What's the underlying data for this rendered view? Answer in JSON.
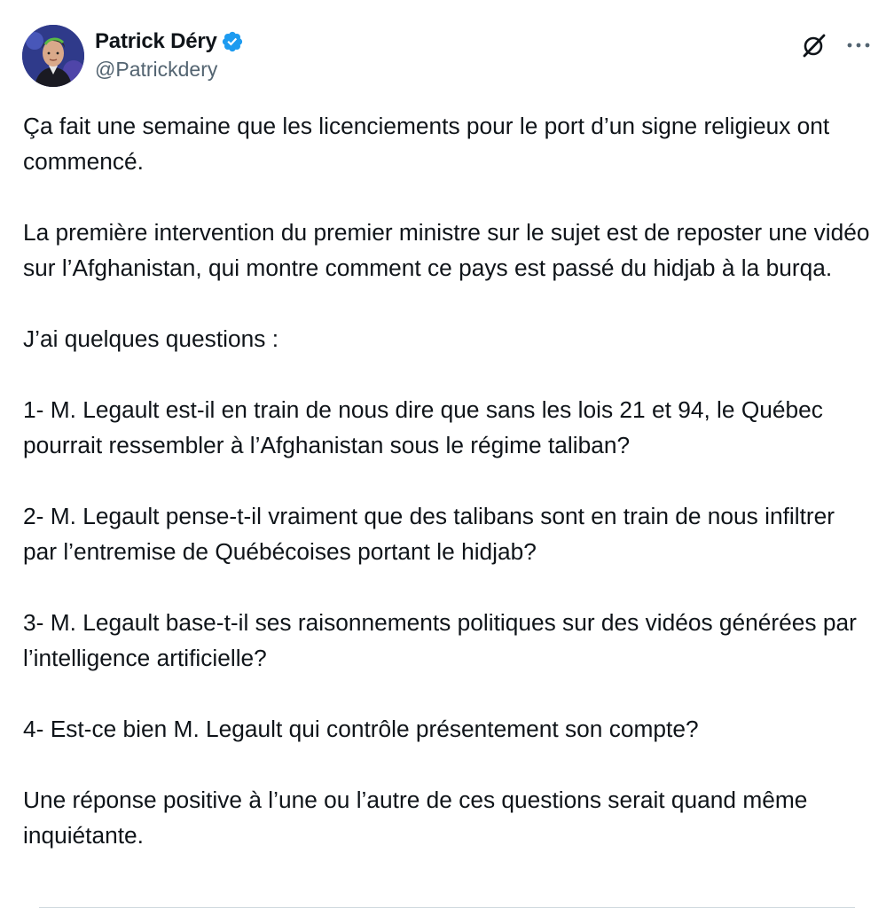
{
  "author": {
    "display_name": "Patrick Déry",
    "handle": "@Patrickdery",
    "verified": true,
    "verified_color": "#1d9bf0"
  },
  "actions": {
    "grok_icon": "grok-icon",
    "more_icon": "more-icon"
  },
  "tweet": {
    "paragraphs": [
      "Ça fait une semaine que les licenciements pour le port d’un signe religieux ont commencé.",
      "La première intervention du premier ministre sur le sujet est de reposter une vidéo sur l’Afghanistan, qui montre comment ce pays est passé du hidjab à la burqa.",
      "J’ai quelques questions :",
      "1- M. Legault est-il en train de nous dire que sans les lois 21 et 94, le Québec pourrait ressembler à l’Afghanistan sous le régime taliban?",
      "2- M. Legault pense-t-il vraiment que des talibans sont en train de nous infiltrer par l’entremise de Québécoises portant le hidjab?",
      "3- M. Legault base-t-il ses raisonnements politiques sur des vidéos générées par l’intelligence artificielle?",
      "4- Est-ce bien M. Legault qui contrôle présentement son compte?",
      "Une réponse positive à l’une ou l’autre de ces questions serait quand même inquiétante."
    ]
  }
}
